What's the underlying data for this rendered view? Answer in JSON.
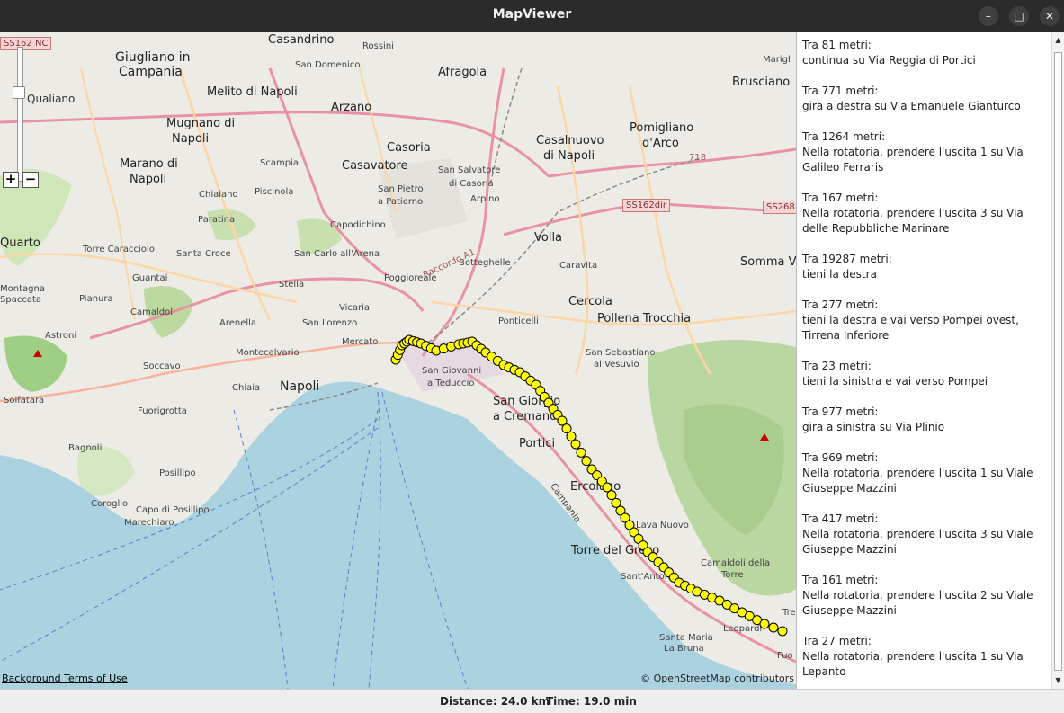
{
  "window": {
    "title": "MapViewer",
    "minimize_glyph": "–",
    "maximize_glyph": "□",
    "close_glyph": "✕"
  },
  "map": {
    "zoom_in_label": "+",
    "zoom_out_label": "−",
    "terms_link": "Background Terms of Use",
    "attribution": "© OpenStreetMap contributors",
    "shields": [
      "SS162 NC",
      "SS162dir",
      "SS268"
    ],
    "shield_numbers": [
      "718"
    ],
    "places": [
      "Casandrino",
      "Rossini",
      "Giugliano in",
      "Campania",
      "Qualiano",
      "San Domenico",
      "Afragola",
      "Melito di Napoli",
      "Arzano",
      "Mugnano di",
      "Napoli",
      "Casoria",
      "Casalnuovo",
      "di Napoli",
      "Pomigliano",
      "d'Arco",
      "Brusciano",
      "Marano di",
      "Napoli",
      "Casavatore",
      "Scampia",
      "San Salvatore",
      "di Casoria",
      "San Pietro",
      "a Patierno",
      "Arpino",
      "Chiaiano",
      "Piscinola",
      "Paratina",
      "Capodichino",
      "Quarto",
      "Torre Caracciolo",
      "Santa Croce",
      "Volla",
      "Caravita",
      "Somma Ve",
      "San Carlo all'Arena",
      "Botteghelle",
      "Poggioreale",
      "Guantai",
      "Stella",
      "Montagna",
      "Spaccata",
      "Pianura",
      "Camaldoli",
      "Vicaria",
      "Ponticelli",
      "Cercola",
      "Pollena Trocchia",
      "Arenella",
      "San Lorenzo",
      "Mercato",
      "Astroni",
      "Montecalvario",
      "San Giovanni",
      "a Teduccio",
      "San Sebastiano",
      "al Vesuvio",
      "Soccavo",
      "Chiaia",
      "Napoli",
      "Solfatara",
      "Fuorigrotta",
      "San Giorgio",
      "a Cremano",
      "Portici",
      "Bagnoli",
      "Posillipo",
      "Ercolano",
      "Coroglio",
      "Capo di Posillipo",
      "Marechiaro",
      "Campania",
      "Lava Nuovo",
      "Torre del Greco",
      "Sant'Antonio",
      "Camaldoli della",
      "Torre",
      "Leopardi",
      "Santa Maria",
      "La Bruna",
      "Fuo",
      "Marigl",
      "Raccordo A1",
      "Tre"
    ]
  },
  "panel": {
    "instructions": [
      {
        "distance": "Tra 81 metri:",
        "text": "continua su Via Reggia di Portici"
      },
      {
        "distance": "Tra 771 metri:",
        "text": "gira a destra su Via Emanuele Gianturco"
      },
      {
        "distance": "Tra 1264 metri:",
        "text": "Nella rotatoria, prendere l'uscita 1 su Via Galileo Ferraris"
      },
      {
        "distance": "Tra 167 metri:",
        "text": "Nella rotatoria, prendere l'uscita 3 su Via delle Repubbliche Marinare"
      },
      {
        "distance": "Tra 19287 metri:",
        "text": "tieni la destra"
      },
      {
        "distance": "Tra 277 metri:",
        "text": "tieni la destra e vai verso Pompei ovest, Tirrena Inferiore"
      },
      {
        "distance": "Tra 23 metri:",
        "text": "tieni la sinistra e vai verso Pompei"
      },
      {
        "distance": "Tra 977 metri:",
        "text": "gira a sinistra su Via Plinio"
      },
      {
        "distance": "Tra 969 metri:",
        "text": "Nella rotatoria, prendere l'uscita 1 su Viale Giuseppe Mazzini"
      },
      {
        "distance": "Tra 417 metri:",
        "text": "Nella rotatoria, prendere l'uscita 3 su Viale Giuseppe Mazzini"
      },
      {
        "distance": "Tra 161 metri:",
        "text": "Nella rotatoria, prendere l'uscita 2 su Viale Giuseppe Mazzini"
      },
      {
        "distance": "Tra 27 metri:",
        "text": "Nella rotatoria, prendere l'uscita 1 su Via Lepanto"
      }
    ]
  },
  "status": {
    "distance": "Distance: 24.0 km",
    "time": "Time: 19.0 min"
  },
  "colors": {
    "sea": "#aad3df",
    "land": "#f2efe9",
    "park": "#c8e0b0",
    "forest": "#addd8e",
    "urban": "#e0dfdf",
    "motorway": "#e892a2",
    "trunk": "#f9b29c",
    "primary": "#fcd6a4",
    "route_marker": "#ffff00"
  }
}
